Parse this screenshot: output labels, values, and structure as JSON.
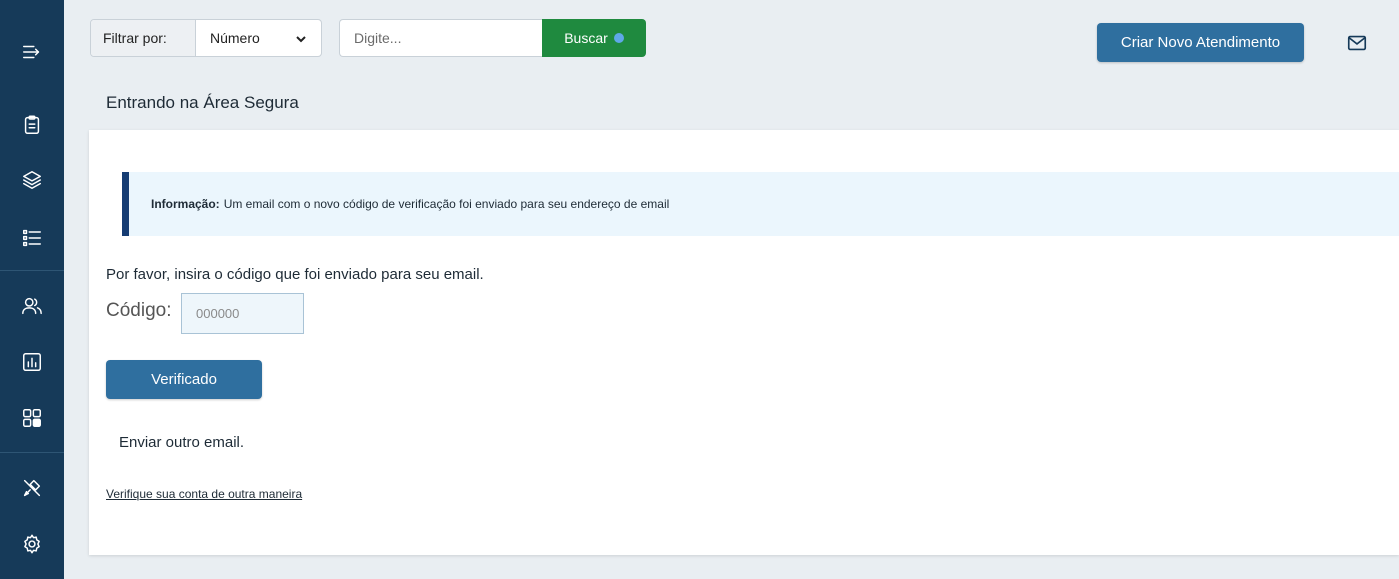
{
  "sidebar": {
    "items": [
      {
        "icon": "menu-arrow-icon"
      },
      {
        "icon": "clipboard-icon"
      },
      {
        "icon": "layers-icon"
      },
      {
        "icon": "checklist-icon"
      },
      {
        "icon": "users-icon"
      },
      {
        "icon": "chart-icon"
      },
      {
        "icon": "apps-icon"
      },
      {
        "icon": "tools-icon"
      },
      {
        "icon": "gear-icon"
      }
    ]
  },
  "topbar": {
    "filter_label": "Filtrar por:",
    "filter_value": "Número",
    "search_placeholder": "Digite...",
    "search_button": "Buscar",
    "create_button": "Criar Novo Atendimento",
    "mail_icon": "mail-icon"
  },
  "page": {
    "title": "Entrando na Área Segura"
  },
  "alert": {
    "label": "Informação:",
    "message": "Um email com o novo código de verificação foi enviado para seu endereço de email"
  },
  "form": {
    "instruction": "Por favor, insira o código que foi enviado para seu email.",
    "code_label": "Código:",
    "code_placeholder": "000000",
    "verify_button": "Verificado",
    "resend_text": "Enviar outro email.",
    "alt_link": "Verifique sua conta de outra maneira"
  },
  "colors": {
    "sidebar_bg": "#163a59",
    "primary_button": "#2f6f9f",
    "search_button": "#1f8a3f",
    "alert_border": "#153c73",
    "alert_bg": "#ebf6fd"
  }
}
